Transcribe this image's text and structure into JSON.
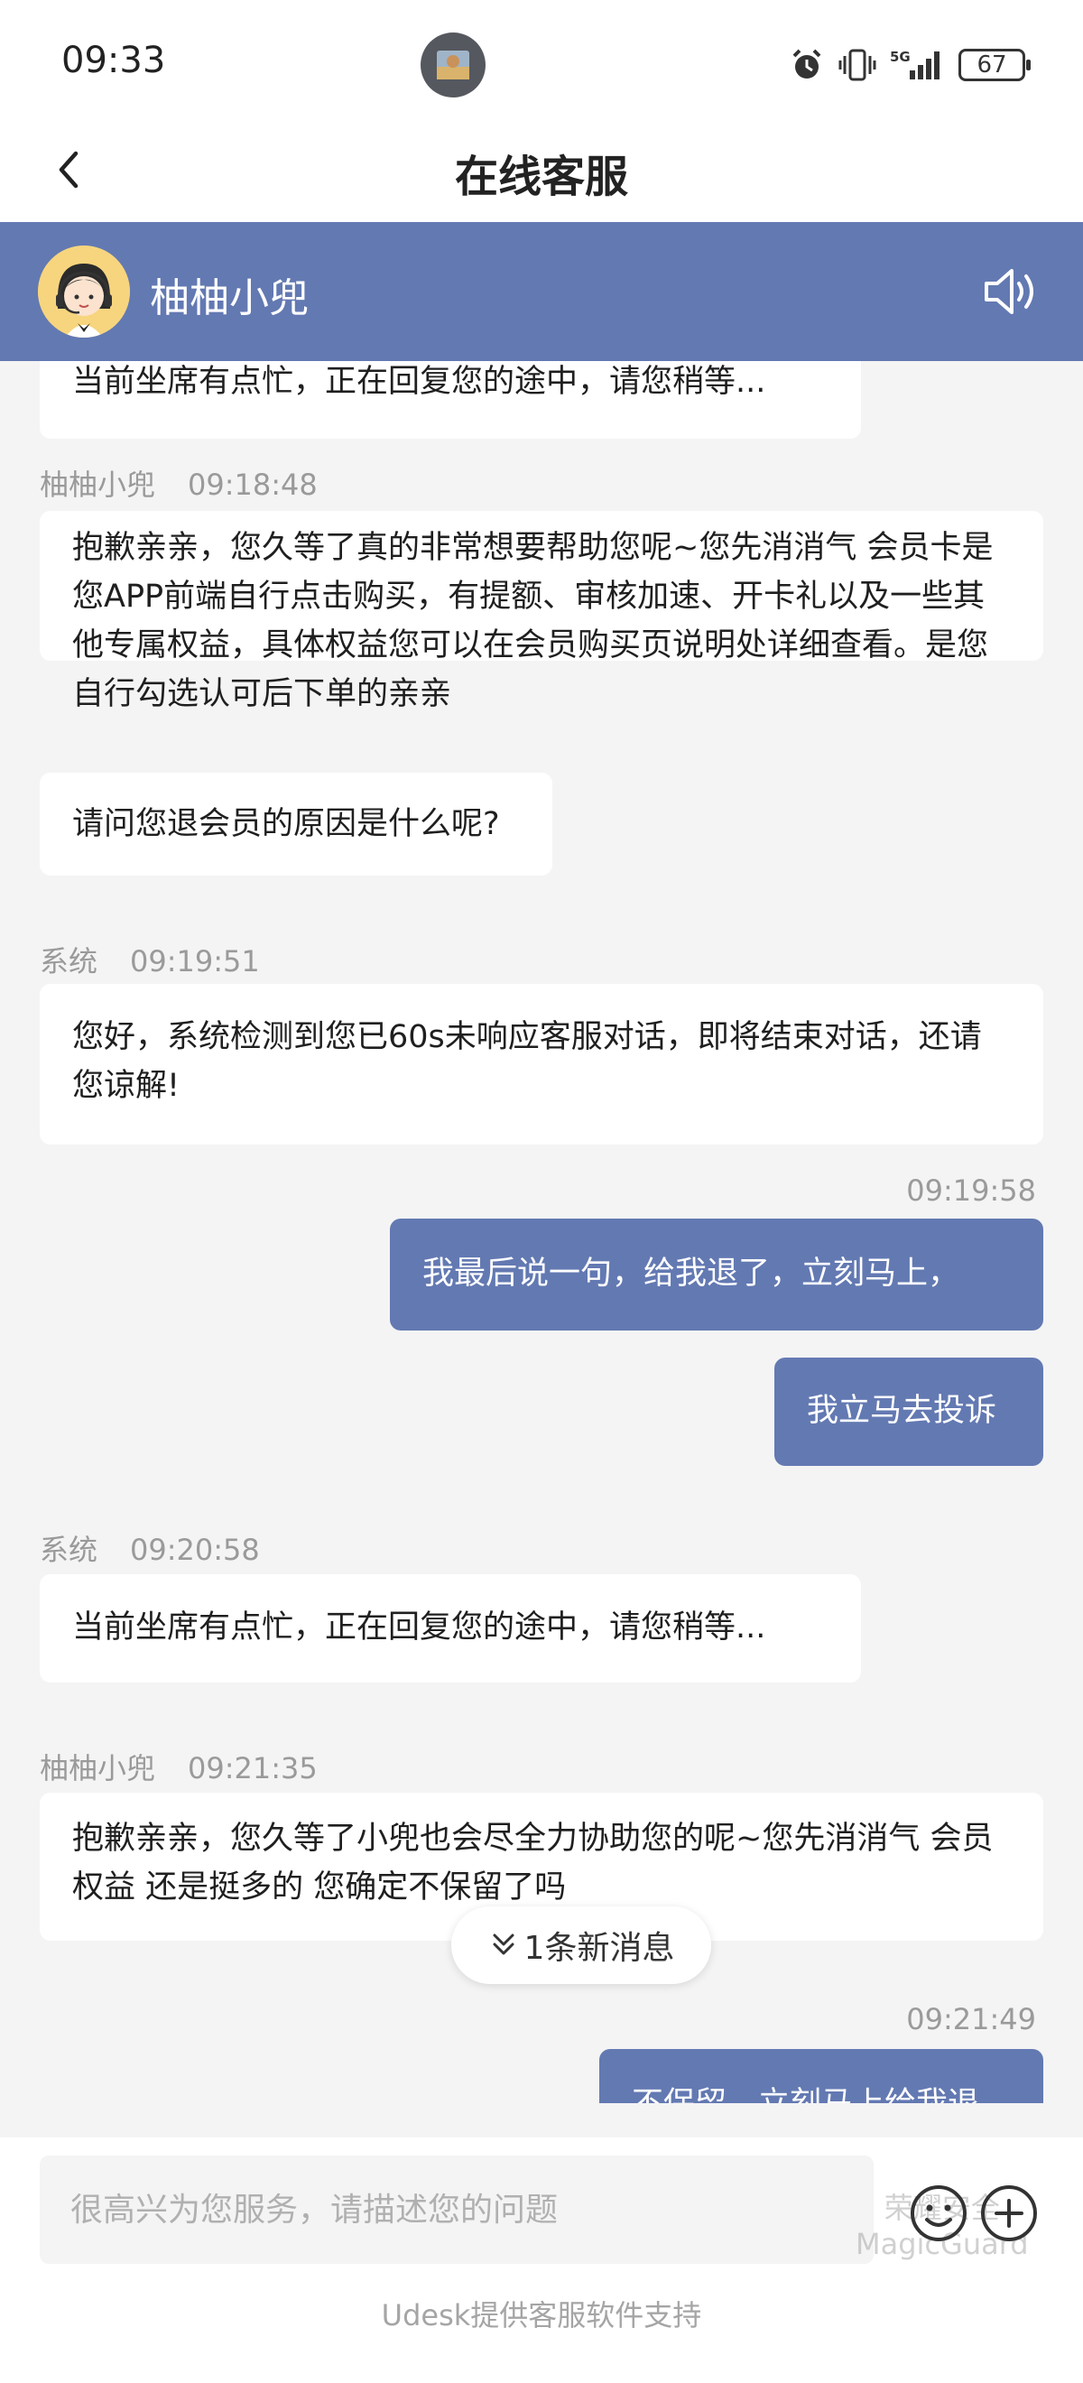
{
  "status_bar": {
    "time": "09:33",
    "network": "5G",
    "battery": "67"
  },
  "header": {
    "title": "在线客服",
    "agent_name": "柚柚小兜"
  },
  "messages": {
    "m1": {
      "text": "当前坐席有点忙，正在回复您的途中，请您稍等..."
    },
    "m2": {
      "sender": "柚柚小兜",
      "time": "09:18:48",
      "text": "抱歉亲亲，您久等了真的非常想要帮助您呢~您先消消气 会员卡是您APP前端自行点击购买，有提额、审核加速、开卡礼以及一些其他专属权益，具体权益您可以在会员购买页说明处详细查看。是您自行勾选认可后下单的亲亲"
    },
    "m3": {
      "text": "请问您退会员的原因是什么呢?"
    },
    "m4": {
      "sender": "系统",
      "time": "09:19:51",
      "text": "您好，系统检测到您已60s未响应客服对话，即将结束对话，还请您谅解!"
    },
    "m5": {
      "time": "09:19:58",
      "text": "我最后说一句，给我退了，立刻马上，"
    },
    "m6": {
      "text": "我立马去投诉"
    },
    "m7": {
      "sender": "系统",
      "time": "09:20:58",
      "text": "当前坐席有点忙，正在回复您的途中，请您稍等..."
    },
    "m8": {
      "sender": "柚柚小兜",
      "time": "09:21:35",
      "text": "抱歉亲亲，您久等了小兜也会尽全力协助您的呢~您先消消气 会员权益 还是挺多的 您确定不保留了吗"
    },
    "m9": {
      "time": "09:21:49",
      "text": "不保留，立刻马上给我退"
    }
  },
  "new_message_pill": {
    "label": "1条新消息",
    "icon": "double-chevron-down-icon"
  },
  "input": {
    "placeholder": "很高兴为您服务，请描述您的问题",
    "watermark_line1": "荣耀安全",
    "watermark_line2": "MagicGuard"
  },
  "footer": {
    "note": "Udesk提供客服软件支持"
  },
  "colors": {
    "accent": "#6379b2",
    "bubble_in": "#ffffff",
    "background": "#f4f4f4",
    "meta_text": "#9a9a9a"
  }
}
